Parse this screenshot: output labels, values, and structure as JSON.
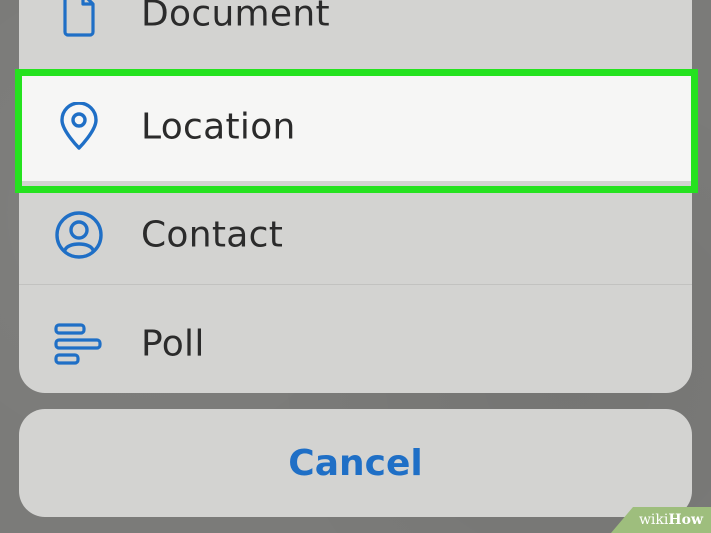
{
  "menu": {
    "items": [
      {
        "label": "Document",
        "icon": "document-icon"
      },
      {
        "label": "Location",
        "icon": "location-pin-icon",
        "highlighted": true
      },
      {
        "label": "Contact",
        "icon": "contact-icon"
      },
      {
        "label": "Poll",
        "icon": "poll-icon"
      }
    ]
  },
  "cancel": {
    "label": "Cancel"
  },
  "watermark": {
    "wiki": "wiki",
    "how": "How"
  },
  "colors": {
    "accent": "#1f6fc6",
    "highlight": "#25e21f",
    "sheet": "#d3d3d1",
    "selected_row": "#f6f6f5",
    "backdrop": "#7b7b79"
  }
}
